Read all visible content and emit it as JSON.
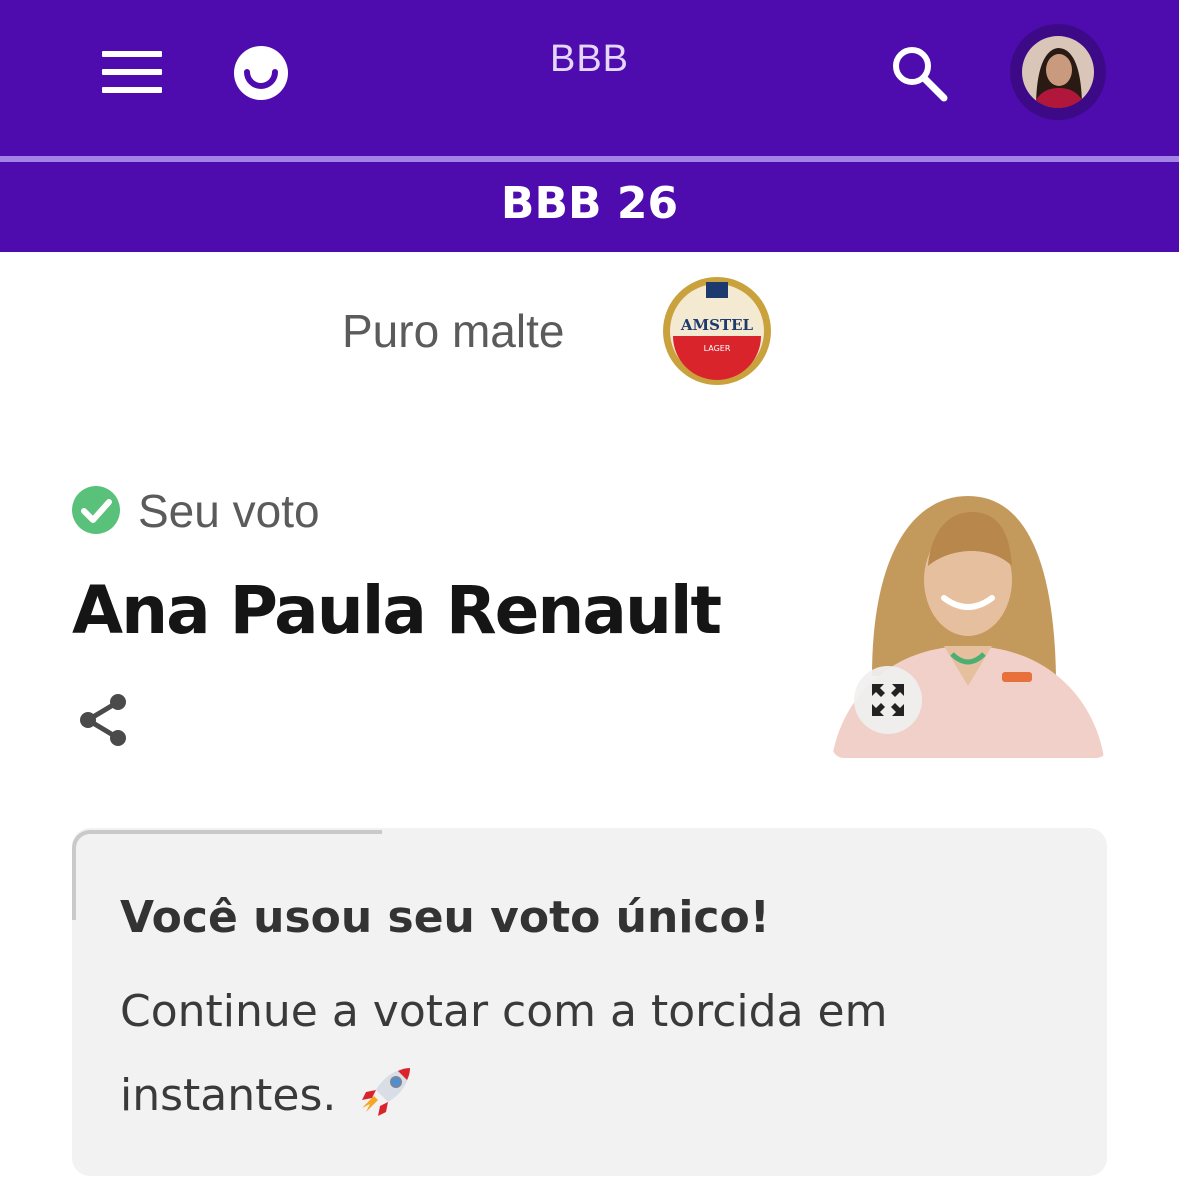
{
  "header": {
    "app_title": "BBB",
    "section_title": "BBB 26",
    "icons": {
      "menu": "hamburger-menu-icon",
      "logo": "smiley-logo-icon",
      "search": "search-icon",
      "avatar": "user-avatar"
    }
  },
  "sponsor": {
    "text": "Puro malte",
    "logo_text": "AMSTEL",
    "logo_subtext": "LAGER"
  },
  "vote": {
    "status_label": "Seu voto",
    "candidate_name": "Ana Paula Renault",
    "icons": {
      "status": "check-circle-icon",
      "share": "share-icon",
      "expand": "expand-icon"
    }
  },
  "notice": {
    "title": "Você usou seu voto único!",
    "body": "Continue a votar com a torcida em instantes.",
    "emoji": "rocket-icon"
  },
  "colors": {
    "brand_purple": "#4e0bad",
    "divider_lavender": "#a383e6",
    "success_green": "#5ac17a",
    "card_background": "#f2f2f2"
  }
}
